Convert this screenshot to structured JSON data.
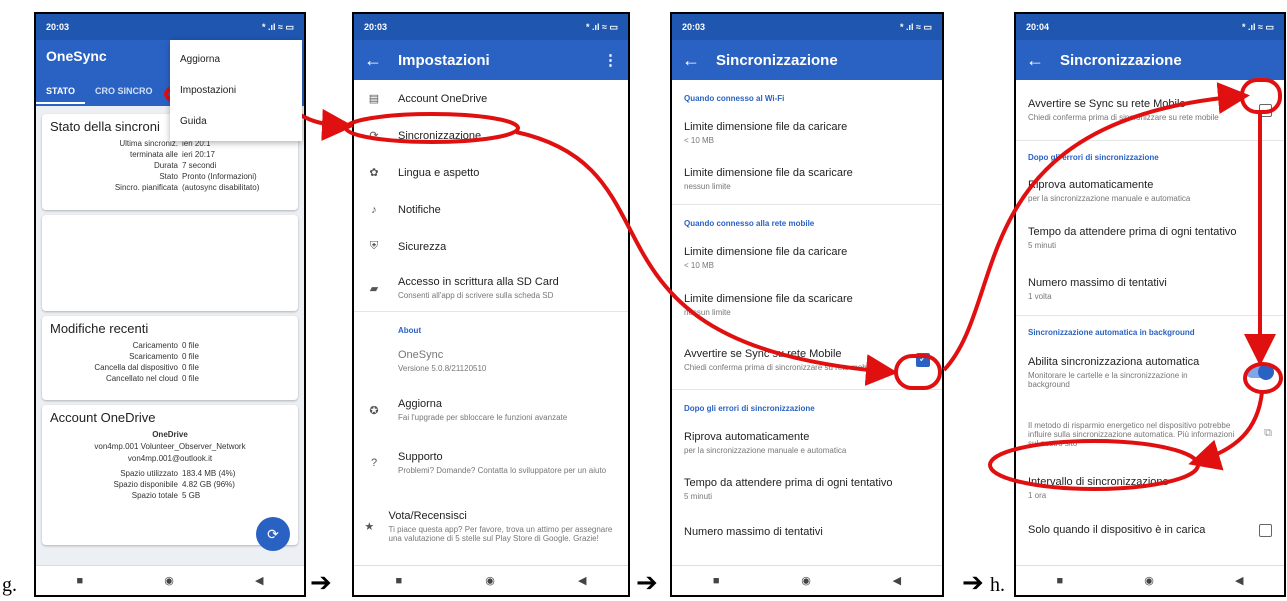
{
  "labels": {
    "g": "g.",
    "h": "h.",
    "arrow": "➔"
  },
  "p1": {
    "time": "20:03",
    "status_right": "* .ıl ≈ ▭",
    "app_title": "OneSync",
    "tabs": [
      "STATO",
      "CRO SINCRO"
    ],
    "menu": [
      "Aggiorna",
      "Impostazioni",
      "Guida"
    ],
    "status_card": {
      "title": "Stato della sincroni",
      "rows": [
        [
          "Ultima sincroniz.",
          "ieri 20:1"
        ],
        [
          "terminata alle",
          "ieri 20:17"
        ],
        [
          "Durata",
          "7 secondi"
        ],
        [
          "Stato",
          "Pronto (Informazioni)"
        ],
        [
          "Sincro. pianificata",
          "(autosync disabilitato)"
        ]
      ]
    },
    "recent_card": {
      "title": "Modifiche recenti",
      "rows": [
        [
          "Caricamento",
          "0 file"
        ],
        [
          "Scaricamento",
          "0 file"
        ],
        [
          "Cancella dal dispositivo",
          "0 file"
        ],
        [
          "Cancellato nel cloud",
          "0 file"
        ]
      ]
    },
    "account_card": {
      "title": "Account OneDrive",
      "name": "OneDrive",
      "user": "von4mp.001 Volunteer_Observer_Network",
      "email": "von4mp.001@outlook.it",
      "rows": [
        [
          "Spazio utilizzato",
          "183.4 MB (4%)"
        ],
        [
          "Spazio disponibile",
          "4.82 GB (96%)"
        ],
        [
          "Spazio totale",
          "5 GB"
        ]
      ]
    }
  },
  "p2": {
    "time": "20:03",
    "status_right": "* .ıl ≈ ▭",
    "title": "Impostazioni",
    "items": [
      {
        "t": "Account OneDrive",
        "s": ""
      },
      {
        "t": "Sincronizzazione",
        "s": ""
      },
      {
        "t": "Lingua e aspetto",
        "s": ""
      },
      {
        "t": "Notifiche",
        "s": ""
      },
      {
        "t": "Sicurezza",
        "s": ""
      },
      {
        "t": "Accesso in scrittura alla SD Card",
        "s": "Consenti all'app di scrivere sulla scheda SD"
      }
    ],
    "about_header": "About",
    "app_name": "OneSync",
    "version": "Versione 5.0.8/21120510",
    "items2": [
      {
        "t": "Aggiorna",
        "s": "Fai l'upgrade per sbloccare le funzioni avanzate"
      },
      {
        "t": "Supporto",
        "s": "Problemi? Domande? Contatta lo sviluppatore per un aiuto"
      },
      {
        "t": "Vota/Recensisci",
        "s": "Ti piace questa app? Per favore, trova un attimo per assegnare una valutazione di 5 stelle sul Play Store di Google. Grazie!"
      }
    ]
  },
  "p3": {
    "time": "20:03",
    "status_right": "* .ıl ≈ ▭",
    "title": "Sincronizzazione",
    "h1": "Quando connesso al Wi-Fi",
    "wifi": [
      {
        "t": "Limite dimensione file da caricare",
        "s": "< 10 MB"
      },
      {
        "t": "Limite dimensione file da scaricare",
        "s": "nessun limite"
      }
    ],
    "h2": "Quando connesso alla rete mobile",
    "mob": [
      {
        "t": "Limite dimensione file da caricare",
        "s": "< 10 MB"
      },
      {
        "t": "Limite dimensione file da scaricare",
        "s": "nessun limite"
      }
    ],
    "warn": {
      "t": "Avvertire se Sync su rete Mobile",
      "s": "Chiedi conferma prima di sincronizzare su rete mobile"
    },
    "h3": "Dopo gli errori di sincronizzazione",
    "err": [
      {
        "t": "Riprova automaticamente",
        "s": "per la sincronizzazione manuale e automatica"
      },
      {
        "t": "Tempo da attendere prima di ogni tentativo",
        "s": "5 minuti"
      },
      {
        "t": "Numero massimo di tentativi",
        "s": ""
      }
    ]
  },
  "p4": {
    "time": "20:04",
    "status_right": "* .ıl ≈ ▭",
    "title": "Sincronizzazione",
    "warn": {
      "t": "Avvertire se Sync su rete Mobile",
      "s": "Chiedi conferma prima di sincronizzare su rete mobile"
    },
    "h1": "Dopo gli errori di sincronizzazione",
    "err": [
      {
        "t": "Riprova automaticamente",
        "s": "per la sincronizzazione manuale e automatica"
      },
      {
        "t": "Tempo da attendere prima di ogni tentativo",
        "s": "5 minuti"
      },
      {
        "t": "Numero massimo di tentativi",
        "s": "1 volta"
      }
    ],
    "h2": "Sincronizzazione automatica in background",
    "auto": {
      "t": "Abilita sincronizzaziona automatica",
      "s": "Monitorare le cartelle e la sincronizzazione in background"
    },
    "note": "Il metodo di risparmio energetico nel dispositivo potrebbe influire sulla sincronizzazione automatica. Più informazioni sul nostro sito",
    "interval": {
      "t": "Intervallo di sincronizzazione",
      "s": "1 ora"
    },
    "charge": {
      "t": "Solo quando il dispositivo è in carica"
    }
  },
  "colors": {
    "primary": "#2a62c4",
    "annotation": "#e01010"
  }
}
